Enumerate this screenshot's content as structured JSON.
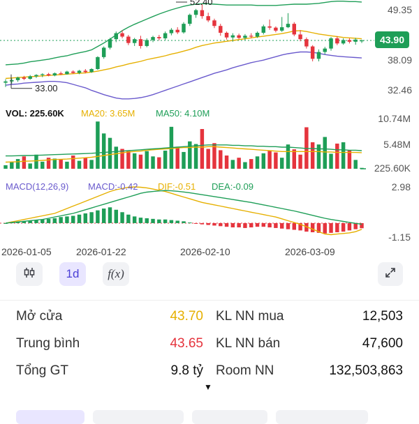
{
  "colors": {
    "up": "#1e9e57",
    "down": "#e5343d",
    "ma20": "#e6b000",
    "ma50": "#1e9e57",
    "bb_lower": "#6a5acd",
    "active_tab": "#4b3fd6"
  },
  "price_panel": {
    "high_label": "52.40",
    "low_label": "33.00",
    "current_badge": "43.90",
    "axis_ticks": [
      "49.35",
      "38.09",
      "32.46"
    ]
  },
  "volume_panel": {
    "legend_vol": "VOL: 225.60K",
    "legend_ma20": "MA20: 3.65M",
    "legend_ma50": "MA50: 4.10M",
    "axis_ticks": [
      "10.74M",
      "5.48M",
      "225.60K"
    ]
  },
  "macd_panel": {
    "legend_params": "MACD(12,26,9)",
    "legend_macd": "MACD:-0.42",
    "legend_dif": "DIF:-0.51",
    "legend_dea": "DEA:-0.09",
    "axis_ticks": [
      "2.98",
      "-1.15"
    ]
  },
  "date_labels": [
    "2026-01-05",
    "2026-01-22",
    "2026-02-10",
    "2026-03-09"
  ],
  "toolbar": {
    "candle_icon": "candlestick-icon",
    "interval_label": "1d",
    "fx_label": "f(x)",
    "expand_icon": "expand-icon"
  },
  "stats": [
    {
      "label": "Mở cửa",
      "value": "43.70",
      "value_color": "#e6b000",
      "label2": "KL NN mua",
      "value2": "12,503"
    },
    {
      "label": "Trung bình",
      "value": "43.65",
      "value_color": "#e5343d",
      "label2": "KL NN bán",
      "value2": "47,600"
    },
    {
      "label": "Tổng GT",
      "value": "9.8 tỷ",
      "value_color": "#111111",
      "label2": "Room NN",
      "value2": "132,503,863"
    }
  ],
  "more_caret": "▼",
  "chart_data": {
    "type": "candlestick",
    "y_range": [
      32.46,
      52.4
    ],
    "x_dates": [
      "2026-01-05",
      "2026-01-22",
      "2026-02-10",
      "2026-03-09"
    ],
    "candles": [
      {
        "o": 34.0,
        "h": 34.8,
        "l": 33.0,
        "c": 34.3
      },
      {
        "o": 34.3,
        "h": 35.0,
        "l": 33.8,
        "c": 34.6
      },
      {
        "o": 34.6,
        "h": 35.4,
        "l": 34.2,
        "c": 35.2
      },
      {
        "o": 35.2,
        "h": 35.6,
        "l": 34.6,
        "c": 34.9
      },
      {
        "o": 34.9,
        "h": 35.8,
        "l": 34.7,
        "c": 35.5
      },
      {
        "o": 35.5,
        "h": 36.0,
        "l": 35.1,
        "c": 35.8
      },
      {
        "o": 35.8,
        "h": 36.2,
        "l": 35.3,
        "c": 36.0
      },
      {
        "o": 36.0,
        "h": 36.3,
        "l": 35.5,
        "c": 35.7
      },
      {
        "o": 35.7,
        "h": 36.4,
        "l": 35.5,
        "c": 36.2
      },
      {
        "o": 36.2,
        "h": 36.6,
        "l": 35.8,
        "c": 36.0
      },
      {
        "o": 36.0,
        "h": 36.8,
        "l": 35.9,
        "c": 36.6
      },
      {
        "o": 36.6,
        "h": 36.9,
        "l": 36.1,
        "c": 36.3
      },
      {
        "o": 36.3,
        "h": 37.0,
        "l": 36.0,
        "c": 36.8
      },
      {
        "o": 36.8,
        "h": 37.2,
        "l": 36.2,
        "c": 36.5
      },
      {
        "o": 36.5,
        "h": 37.4,
        "l": 36.3,
        "c": 37.2
      },
      {
        "o": 37.2,
        "h": 40.2,
        "l": 37.0,
        "c": 40.0
      },
      {
        "o": 40.0,
        "h": 42.5,
        "l": 39.6,
        "c": 42.2
      },
      {
        "o": 42.2,
        "h": 44.5,
        "l": 41.8,
        "c": 44.2
      },
      {
        "o": 44.2,
        "h": 46.0,
        "l": 43.5,
        "c": 45.6
      },
      {
        "o": 45.6,
        "h": 46.3,
        "l": 44.4,
        "c": 44.8
      },
      {
        "o": 44.8,
        "h": 45.2,
        "l": 42.8,
        "c": 43.3
      },
      {
        "o": 43.3,
        "h": 44.5,
        "l": 42.6,
        "c": 44.2
      },
      {
        "o": 44.2,
        "h": 45.0,
        "l": 42.0,
        "c": 42.6
      },
      {
        "o": 42.6,
        "h": 44.4,
        "l": 42.3,
        "c": 44.0
      },
      {
        "o": 44.0,
        "h": 45.0,
        "l": 43.5,
        "c": 44.7
      },
      {
        "o": 44.7,
        "h": 45.2,
        "l": 43.9,
        "c": 44.4
      },
      {
        "o": 44.4,
        "h": 46.0,
        "l": 44.0,
        "c": 45.6
      },
      {
        "o": 45.6,
        "h": 46.8,
        "l": 45.1,
        "c": 46.4
      },
      {
        "o": 46.4,
        "h": 47.0,
        "l": 45.4,
        "c": 45.8
      },
      {
        "o": 45.8,
        "h": 48.2,
        "l": 45.5,
        "c": 47.8
      },
      {
        "o": 47.8,
        "h": 50.2,
        "l": 47.3,
        "c": 49.9
      },
      {
        "o": 49.9,
        "h": 51.3,
        "l": 49.2,
        "c": 51.0
      },
      {
        "o": 51.0,
        "h": 52.4,
        "l": 49.0,
        "c": 49.6
      },
      {
        "o": 49.6,
        "h": 50.4,
        "l": 48.2,
        "c": 48.6
      },
      {
        "o": 48.6,
        "h": 49.0,
        "l": 46.8,
        "c": 47.3
      },
      {
        "o": 47.3,
        "h": 47.8,
        "l": 45.0,
        "c": 45.7
      },
      {
        "o": 45.7,
        "h": 46.0,
        "l": 44.1,
        "c": 44.6
      },
      {
        "o": 44.6,
        "h": 45.6,
        "l": 43.6,
        "c": 45.1
      },
      {
        "o": 45.1,
        "h": 45.5,
        "l": 44.2,
        "c": 44.5
      },
      {
        "o": 44.5,
        "h": 45.4,
        "l": 44.0,
        "c": 45.0
      },
      {
        "o": 45.0,
        "h": 45.6,
        "l": 44.4,
        "c": 44.8
      },
      {
        "o": 44.8,
        "h": 46.0,
        "l": 44.5,
        "c": 45.7
      },
      {
        "o": 45.7,
        "h": 47.6,
        "l": 45.3,
        "c": 47.2
      },
      {
        "o": 47.2,
        "h": 48.8,
        "l": 46.4,
        "c": 46.9
      },
      {
        "o": 46.9,
        "h": 47.2,
        "l": 45.8,
        "c": 46.2
      },
      {
        "o": 46.2,
        "h": 49.4,
        "l": 45.9,
        "c": 47.0
      },
      {
        "o": 47.0,
        "h": 50.3,
        "l": 46.8,
        "c": 47.8
      },
      {
        "o": 47.8,
        "h": 48.2,
        "l": 44.9,
        "c": 45.3
      },
      {
        "o": 45.3,
        "h": 46.3,
        "l": 43.7,
        "c": 44.2
      },
      {
        "o": 44.2,
        "h": 44.6,
        "l": 42.0,
        "c": 42.5
      },
      {
        "o": 42.5,
        "h": 42.8,
        "l": 39.0,
        "c": 39.6
      },
      {
        "o": 39.6,
        "h": 41.8,
        "l": 39.0,
        "c": 41.2
      },
      {
        "o": 41.2,
        "h": 42.4,
        "l": 40.6,
        "c": 42.0
      },
      {
        "o": 42.0,
        "h": 44.7,
        "l": 41.5,
        "c": 44.4
      },
      {
        "o": 44.4,
        "h": 44.9,
        "l": 42.8,
        "c": 43.2
      },
      {
        "o": 43.2,
        "h": 44.4,
        "l": 42.9,
        "c": 44.0
      },
      {
        "o": 44.0,
        "h": 44.4,
        "l": 43.2,
        "c": 43.6
      },
      {
        "o": 43.6,
        "h": 44.5,
        "l": 42.9,
        "c": 44.1
      },
      {
        "o": 43.7,
        "h": 44.1,
        "l": 43.3,
        "c": 43.9
      }
    ],
    "ma20": [
      35.0,
      35.1,
      35.2,
      35.3,
      35.4,
      35.5,
      35.6,
      35.7,
      35.8,
      35.9,
      36.0,
      36.1,
      36.2,
      36.3,
      36.5,
      36.7,
      37.0,
      37.3,
      37.7,
      38.0,
      38.4,
      38.7,
      39.0,
      39.4,
      39.7,
      40.0,
      40.3,
      40.7,
      41.0,
      41.4,
      41.8,
      42.3,
      42.7,
      43.0,
      43.3,
      43.5,
      43.7,
      43.9,
      44.1,
      44.3,
      44.5,
      44.7,
      44.9,
      45.1,
      45.3,
      45.5,
      45.8,
      46.1,
      46.2,
      46.0,
      45.7,
      45.4,
      45.2,
      45.0,
      44.8,
      44.6,
      44.5,
      44.4,
      44.3
    ],
    "bb_upper": [
      38.2,
      38.3,
      38.4,
      38.6,
      38.9,
      39.1,
      39.3,
      39.5,
      39.8,
      40.1,
      40.3,
      40.7,
      41.0,
      41.3,
      41.7,
      42.5,
      43.3,
      44.2,
      45.2,
      46.2,
      47.0,
      47.7,
      48.3,
      48.9,
      49.5,
      50.1,
      50.6,
      51.1,
      51.5,
      51.9,
      52.2,
      52.4,
      52.5,
      52.5,
      52.4,
      52.3,
      52.2,
      52.2,
      52.2,
      52.2,
      52.2,
      52.1,
      52.1,
      52.1,
      52.1,
      52.2,
      52.3,
      52.4,
      52.4,
      52.4,
      52.5,
      52.6,
      52.8,
      53.0,
      53.1,
      53.1,
      53.0,
      53.0,
      52.9
    ],
    "bb_lower": [
      33.4,
      33.6,
      33.7,
      33.9,
      34.0,
      34.1,
      34.2,
      34.3,
      34.3,
      34.2,
      34.0,
      33.6,
      33.2,
      32.8,
      32.2,
      31.7,
      31.2,
      30.8,
      30.4,
      30.2,
      30.2,
      30.3,
      30.5,
      30.8,
      31.2,
      31.7,
      32.2,
      32.7,
      33.2,
      33.7,
      34.2,
      34.7,
      35.2,
      35.7,
      36.2,
      36.6,
      37.0,
      37.5,
      37.9,
      38.3,
      38.7,
      39.0,
      39.3,
      39.7,
      40.1,
      40.5,
      40.8,
      41.0,
      41.2,
      41.2,
      41.1,
      40.9,
      40.6,
      40.4,
      40.2,
      40.1,
      40.0,
      39.9,
      39.8
    ],
    "volume": [
      0.8,
      1.5,
      2.2,
      2.8,
      1.2,
      3.2,
      1.6,
      2.5,
      2.3,
      2.2,
      1.6,
      3.0,
      1.8,
      2.5,
      2.0,
      10.7,
      8.0,
      7.0,
      5.0,
      4.5,
      4.0,
      3.5,
      3.2,
      4.0,
      2.8,
      2.6,
      4.1,
      9.5,
      5.0,
      3.8,
      6.2,
      5.6,
      9.0,
      4.5,
      5.8,
      4.2,
      3.0,
      2.0,
      2.5,
      1.5,
      2.2,
      2.8,
      3.5,
      4.1,
      3.7,
      2.5,
      5.5,
      4.4,
      3.2,
      9.4,
      6.0,
      5.5,
      7.2,
      3.4,
      5.7,
      6.0,
      4.1,
      2.0,
      0.2
    ],
    "vol_ma20": [
      1.5,
      1.55,
      1.6,
      1.7,
      1.75,
      1.8,
      1.9,
      2.0,
      2.1,
      2.15,
      2.2,
      2.3,
      2.4,
      2.5,
      2.6,
      2.8,
      3.0,
      3.2,
      3.4,
      3.6,
      3.8,
      3.9,
      4.0,
      4.2,
      4.3,
      4.4,
      4.5,
      4.6,
      4.7,
      4.8,
      4.8,
      4.9,
      4.9,
      5.0,
      5.0,
      4.9,
      4.8,
      4.7,
      4.6,
      4.5,
      4.4,
      4.3,
      4.2,
      4.1,
      4.0,
      3.9,
      3.9,
      3.9,
      3.9,
      3.9,
      3.9,
      3.9,
      3.8,
      3.8,
      3.7,
      3.7,
      3.7,
      3.7,
      3.65
    ],
    "vol_ma50": [
      2.9,
      2.9,
      2.95,
      3.0,
      3.0,
      3.05,
      3.1,
      3.15,
      3.2,
      3.25,
      3.3,
      3.35,
      3.4,
      3.45,
      3.5,
      3.6,
      3.7,
      3.8,
      3.9,
      4.0,
      4.1,
      4.2,
      4.3,
      4.4,
      4.5,
      4.6,
      4.7,
      4.8,
      4.9,
      5.0,
      5.1,
      5.2,
      5.3,
      5.4,
      5.4,
      5.4,
      5.4,
      5.3,
      5.3,
      5.2,
      5.2,
      5.1,
      5.1,
      5.0,
      5.0,
      4.9,
      4.9,
      4.8,
      4.7,
      4.6,
      4.6,
      4.5,
      4.5,
      4.4,
      4.3,
      4.3,
      4.2,
      4.2,
      4.1
    ],
    "macd_hist": [
      0.0,
      0.05,
      0.1,
      0.15,
      0.2,
      0.25,
      0.3,
      0.35,
      0.4,
      0.5,
      0.55,
      0.6,
      0.7,
      0.8,
      0.9,
      1.05,
      1.2,
      1.3,
      1.1,
      0.9,
      0.7,
      0.55,
      0.45,
      0.4,
      0.35,
      0.3,
      0.3,
      0.25,
      0.2,
      0.15,
      0.05,
      -0.05,
      -0.1,
      -0.15,
      -0.2,
      -0.25,
      -0.3,
      -0.35,
      -0.35,
      -0.4,
      -0.35,
      -0.3,
      -0.3,
      -0.35,
      -0.4,
      -0.45,
      -0.5,
      -0.55,
      -0.6,
      -0.7,
      -0.75,
      -0.8,
      -0.85,
      -0.8,
      -0.75,
      -0.7,
      -0.6,
      -0.5,
      -0.42
    ],
    "dif": [
      0.0,
      0.1,
      0.2,
      0.3,
      0.4,
      0.5,
      0.6,
      0.7,
      0.8,
      1.0,
      1.2,
      1.4,
      1.6,
      1.8,
      2.0,
      2.2,
      2.4,
      2.6,
      2.75,
      2.85,
      2.95,
      2.98,
      2.95,
      2.9,
      2.8,
      2.7,
      2.6,
      2.45,
      2.3,
      2.15,
      2.0,
      1.85,
      1.7,
      1.6,
      1.5,
      1.4,
      1.3,
      1.2,
      1.1,
      1.0,
      0.9,
      0.8,
      0.7,
      0.6,
      0.5,
      0.35,
      0.2,
      0.05,
      -0.1,
      -0.3,
      -0.5,
      -0.7,
      -0.9,
      -0.95,
      -0.9,
      -0.85,
      -0.8,
      -0.7,
      -0.51
    ],
    "dea": [
      0.0,
      0.05,
      0.1,
      0.15,
      0.2,
      0.25,
      0.3,
      0.4,
      0.5,
      0.6,
      0.7,
      0.8,
      0.95,
      1.1,
      1.25,
      1.4,
      1.55,
      1.7,
      1.85,
      2.0,
      2.15,
      2.3,
      2.45,
      2.55,
      2.6,
      2.65,
      2.68,
      2.66,
      2.62,
      2.56,
      2.5,
      2.42,
      2.34,
      2.26,
      2.18,
      2.1,
      2.02,
      1.94,
      1.86,
      1.78,
      1.7,
      1.6,
      1.5,
      1.4,
      1.3,
      1.2,
      1.1,
      1.0,
      0.88,
      0.76,
      0.64,
      0.52,
      0.4,
      0.3,
      0.22,
      0.14,
      0.06,
      -0.02,
      -0.09
    ]
  }
}
